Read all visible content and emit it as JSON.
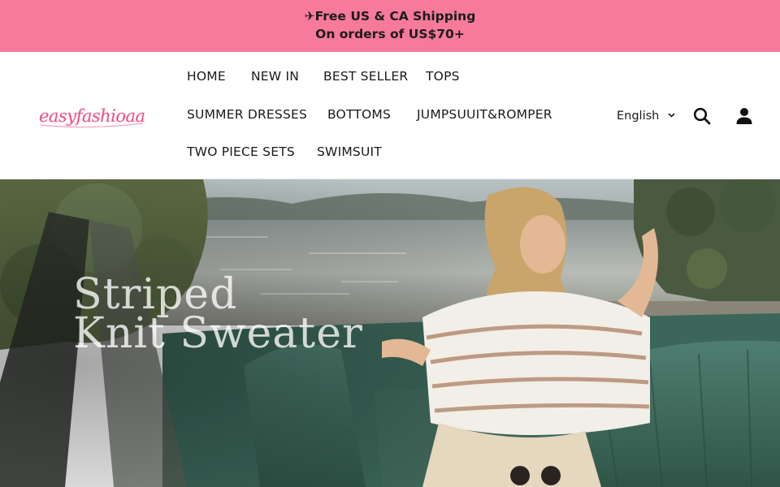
{
  "announcement": {
    "line1": "✈Free US & CA Shipping",
    "line2": "On orders of US$70+"
  },
  "brand": {
    "logo_text": "easyfashioaa",
    "logo_color": "#e8457a"
  },
  "nav": {
    "items": [
      {
        "label": "HOME"
      },
      {
        "label": "NEW IN"
      },
      {
        "label": "BEST SELLER"
      },
      {
        "label": "TOPS"
      },
      {
        "label": "SUMMER DRESSES"
      },
      {
        "label": "BOTTOMS"
      },
      {
        "label": "JUMPSUUIT&ROMPER"
      },
      {
        "label": "TWO PIECE SETS"
      },
      {
        "label": "SWIMSUIT"
      }
    ]
  },
  "header_tools": {
    "language": "English",
    "language_icon": "chevron-down-icon",
    "search_icon": "search-icon",
    "account_icon": "user-icon"
  },
  "hero": {
    "title_line1": "Striped",
    "title_line2": "Knit Sweater"
  },
  "colors": {
    "announcement_bg": "#f77a9b",
    "text": "#1a1a1a"
  }
}
